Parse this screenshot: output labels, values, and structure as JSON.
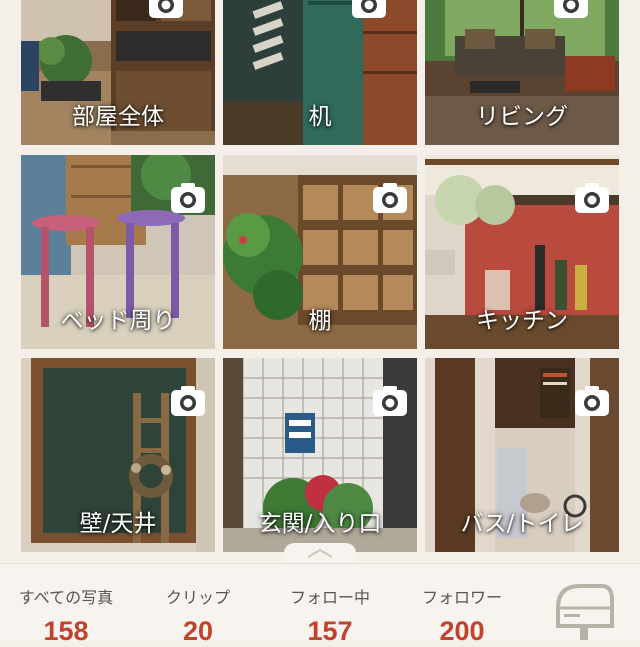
{
  "rooms": [
    {
      "label": "部屋全体"
    },
    {
      "label": "机"
    },
    {
      "label": "リビング"
    },
    {
      "label": "ベッド周り"
    },
    {
      "label": "棚"
    },
    {
      "label": "キッチン"
    },
    {
      "label": "壁/天井"
    },
    {
      "label": "玄関/入り口"
    },
    {
      "label": "バス/トイレ"
    }
  ],
  "stats": [
    {
      "label": "すべての写真",
      "value": "158"
    },
    {
      "label": "クリップ",
      "value": "20"
    },
    {
      "label": "フォロー中",
      "value": "157"
    },
    {
      "label": "フォロワー",
      "value": "200"
    }
  ],
  "colors": {
    "accent": "#c0432e",
    "background": "#f4efe9"
  },
  "icons": {
    "camera": "camera-icon",
    "mailbox": "mailbox-icon",
    "chevron": "chevron-up-icon"
  }
}
